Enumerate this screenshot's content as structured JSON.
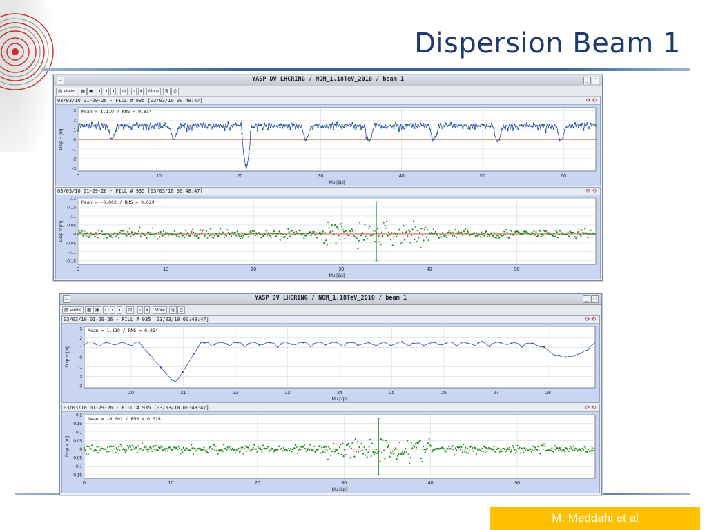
{
  "slide": {
    "title": "Dispersion Beam 1",
    "author": "M. Meddahi et al",
    "logo": "lhc-ring-logo"
  },
  "windows": [
    {
      "title": "YASP DV LHCRING / NOM_1.18TeV_2010 / beam 1",
      "toolbar": {
        "views_label": "Views",
        "more_label": "More"
      },
      "panels": [
        {
          "header": "03/03/10 01-29-26 - FILL # 935  [03/03/10 00:48:47]",
          "stats": "Mean =   1.119 / RMS =   0.814"
        },
        {
          "header": "03/03/10 01-29-26 - FILL # 935  [03/03/10 00:48:47]",
          "stats": "Mean =  -0.002 / RMS =   0.029"
        }
      ]
    },
    {
      "title": "YASP DV LHCRING / NOM_1.18TeV_2010 / beam 1",
      "toolbar": {
        "views_label": "Views",
        "more_label": "More"
      },
      "panels": [
        {
          "header": "03/03/10 01-29-26 - FILL # 935  [03/03/10 00:48:47]",
          "stats": "Mean =   1.119 / RMS =   0.814"
        },
        {
          "header": "03/03/10 01-29-26 - FILL # 935  [03/03/10 00:48:47]",
          "stats": "Mean =  -0.002 / RMS =   0.029"
        }
      ]
    }
  ],
  "colors": {
    "line": "#2b45c8",
    "points": "#1c8a1c",
    "zero_line": "#c0392b",
    "plot_bg": "#ffffff",
    "panel_bg": "#c8d6f4"
  },
  "chart_data": [
    {
      "type": "line",
      "xlabel": "Mu [2pi]",
      "ylabel": "Disp H [m]",
      "xlim": [
        0,
        64
      ],
      "ylim": [
        -3.3,
        3.3
      ],
      "xticks": [
        0,
        10,
        20,
        30,
        40,
        50,
        60
      ],
      "yticks": [
        -3,
        -2,
        -1,
        0,
        1,
        2,
        3
      ],
      "grid": true,
      "series": [
        {
          "pattern": "periodic arc dispersion ~1-2 m, dips near 0 in insertions at Mu≈4, 12, 28, 36, 44, 52, 60; spike to -2.8 at Mu≈21"
        }
      ],
      "dips": [
        [
          4.2,
          0
        ],
        [
          11.9,
          0
        ],
        [
          20.8,
          -2.8
        ],
        [
          28.2,
          0
        ],
        [
          36.0,
          -0.1
        ],
        [
          44.0,
          -0.1
        ],
        [
          51.9,
          -0.2
        ],
        [
          59.7,
          0
        ]
      ]
    },
    {
      "type": "scatter",
      "xlabel": "Mu [2pi]",
      "ylabel": "Disp V [m]",
      "xlim": [
        0,
        59
      ],
      "ylim": [
        -0.17,
        0.2
      ],
      "xticks": [
        0,
        10,
        20,
        30,
        40,
        50
      ],
      "yticks": [
        -0.15,
        -0.1,
        -0.05,
        0,
        0.05,
        0.1,
        0.15,
        0.2
      ],
      "grid": true,
      "noise_rms": 0.029,
      "outlier_center": 34,
      "error_bar": {
        "x": 34,
        "low": -0.15,
        "high": 0.18
      }
    },
    {
      "type": "line",
      "xlabel": "Mu [2pi]",
      "ylabel": "Disp H [m]",
      "xlim": [
        19.1,
        28.9
      ],
      "ylim": [
        -3.2,
        3.2
      ],
      "xticks": [
        20,
        21,
        22,
        23,
        24,
        25,
        26,
        27,
        28
      ],
      "yticks": [
        -3,
        -2,
        -1,
        0,
        1,
        2,
        3
      ],
      "grid": true,
      "dips": [
        [
          20.75,
          -2.8
        ],
        [
          28.35,
          0
        ]
      ]
    },
    {
      "type": "scatter",
      "xlabel": "Mu [2pi]",
      "ylabel": "Disp V [m]",
      "xlim": [
        0,
        59
      ],
      "ylim": [
        -0.17,
        0.2
      ],
      "xticks": [
        0,
        10,
        20,
        30,
        40,
        50
      ],
      "yticks": [
        -0.15,
        -0.1,
        -0.05,
        0,
        0.05,
        0.1,
        0.15,
        0.2
      ],
      "grid": true,
      "noise_rms": 0.029,
      "outlier_center": 34,
      "error_bar": {
        "x": 34,
        "low": -0.15,
        "high": 0.18
      }
    }
  ]
}
